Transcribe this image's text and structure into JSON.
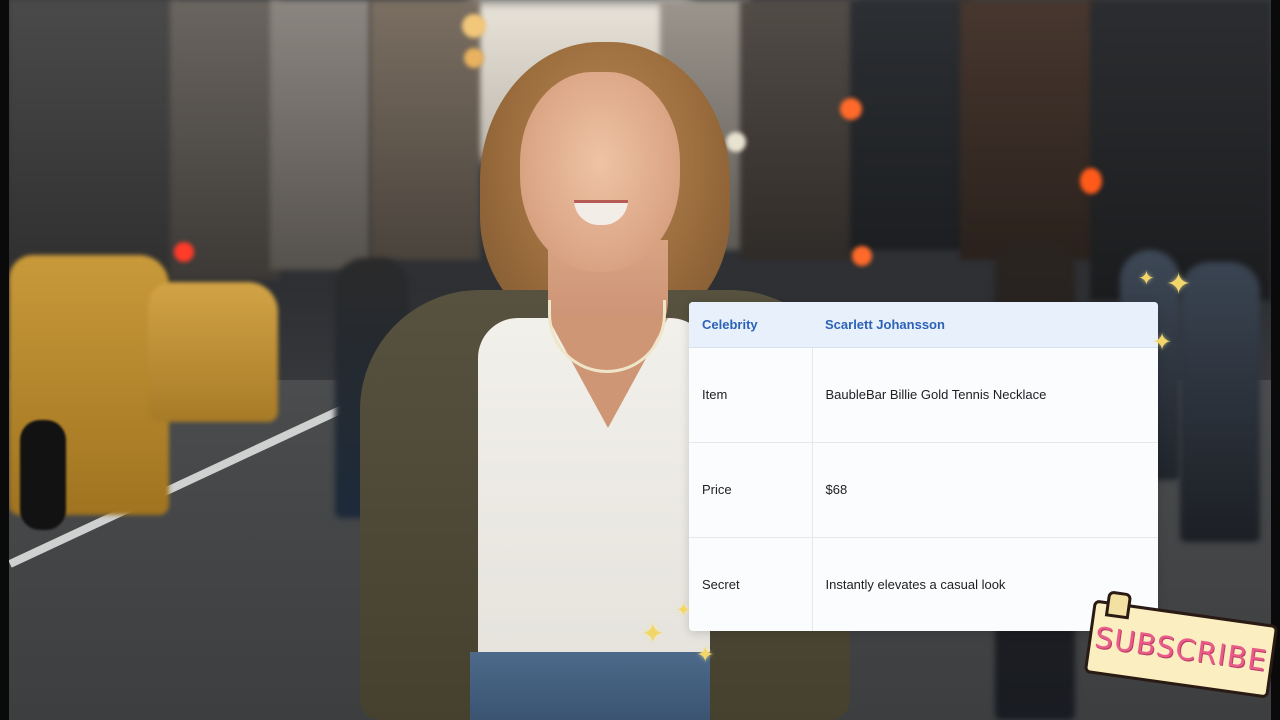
{
  "info_table": {
    "header": {
      "key": "Celebrity",
      "value": "Scarlett Johansson"
    },
    "rows": [
      {
        "key": "Item",
        "value": "BaubleBar Billie Gold Tennis Necklace"
      },
      {
        "key": "Price",
        "value": "$68"
      },
      {
        "key": "Secret",
        "value": "Instantly elevates a casual look"
      }
    ]
  },
  "subscribe": {
    "label": "SUBSCRIBE"
  },
  "sparkle_glyph": "✦",
  "colors": {
    "header_text": "#2c62b8",
    "header_bg": "#e8f0fb",
    "sparkle": "#f3d66a",
    "subscribe_text": "#e95c8a",
    "subscribe_bg": "#fbeec0"
  }
}
